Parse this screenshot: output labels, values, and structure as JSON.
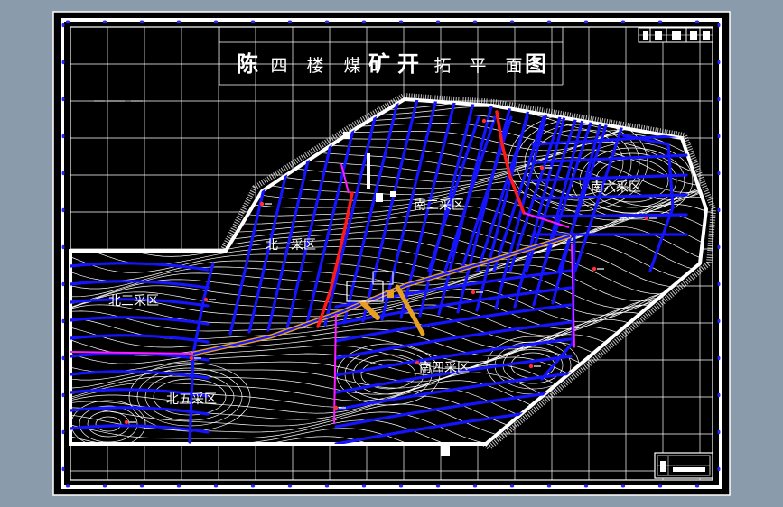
{
  "drawing": {
    "title_chars": [
      "陈",
      "四",
      "楼",
      "煤",
      "矿",
      "开",
      "拓",
      "平",
      "面",
      "图"
    ],
    "title_block_text": "",
    "legend_text": "",
    "colors": {
      "app_background": "#8a9bab",
      "sheet_background": "#000000",
      "frame": "#ffffff",
      "grid": "#ffffff",
      "contour": "#ffffff",
      "roadway": "#1414ff",
      "main_roadway": "#e8a020",
      "fault_red": "#ff1a1a",
      "boundary_magenta": "#ff1aff",
      "label": "#ffffff"
    }
  },
  "districts": [
    {
      "id": "north-1",
      "label": "北一采区"
    },
    {
      "id": "north-3",
      "label": "北三采区"
    },
    {
      "id": "north-5",
      "label": "北五采区"
    },
    {
      "id": "south-2",
      "label": "南二采区"
    },
    {
      "id": "south-4",
      "label": "南四采区"
    },
    {
      "id": "south-6",
      "label": "南六采区"
    }
  ]
}
